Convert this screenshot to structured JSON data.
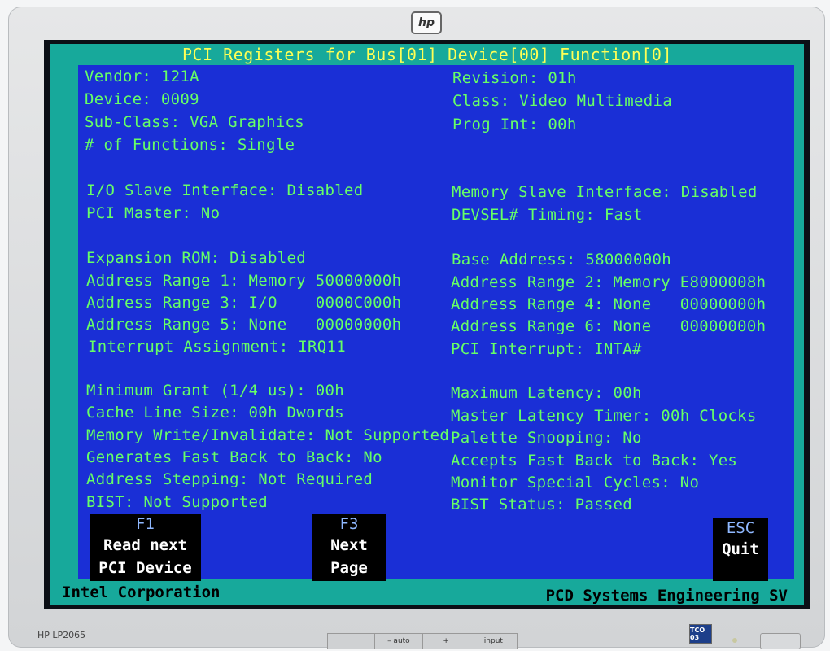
{
  "monitor": {
    "brand_logo": "hp",
    "model": "HP LP2065",
    "buttons": [
      "",
      "–  auto",
      "+",
      "input"
    ],
    "energy_badge": "TCO 03"
  },
  "screen": {
    "title": "PCI Registers for Bus[01] Device[00] Function[0]",
    "left": [
      "Vendor: 121A",
      "Device: 0009",
      "Sub-Class: VGA Graphics",
      "# of Functions: Single",
      "I/O Slave Interface: Disabled",
      "PCI Master: No",
      "Expansion ROM: Disabled",
      "Address Range 1: Memory 50000000h",
      "Address Range 3: I/O    0000C000h",
      "Address Range 5: None   00000000h",
      "Interrupt Assignment: IRQ11",
      "Minimum Grant (1/4 us): 00h",
      "Cache Line Size: 00h Dwords",
      "Memory Write/Invalidate: Not Supported",
      "Generates Fast Back to Back: No",
      "Address Stepping: Not Required",
      "BIST: Not Supported"
    ],
    "right": [
      "Revision: 01h",
      "Class: Video Multimedia",
      "Prog Int: 00h",
      "Memory Slave Interface: Disabled",
      "DEVSEL# Timing: Fast",
      "Base Address: 58000000h",
      "Address Range 2: Memory E8000008h",
      "Address Range 4: None   00000000h",
      "Address Range 6: None   00000000h",
      "PCI Interrupt: INTA#",
      "Maximum Latency: 00h",
      "Master Latency Timer: 00h Clocks",
      "Palette Snooping: No",
      "Accepts Fast Back to Back: Yes",
      "Monitor Special Cycles: No",
      "BIST Status: Passed"
    ],
    "keys": {
      "f1": {
        "key": "F1",
        "line1": "Read next",
        "line2": "PCI Device"
      },
      "f3": {
        "key": "F3",
        "line1": "Next",
        "line2": "Page"
      },
      "esc": {
        "key": "ESC",
        "line1": "Quit"
      }
    },
    "status_left": "Intel Corporation",
    "status_right": "PCD Systems Engineering SV"
  }
}
